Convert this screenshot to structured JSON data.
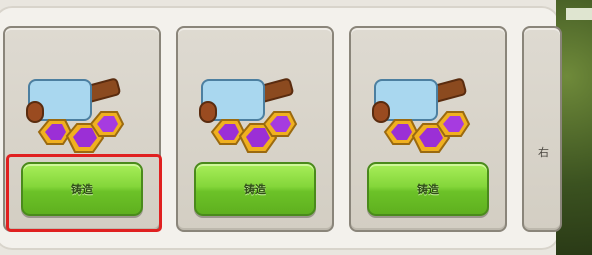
{
  "cards": [
    {
      "button_label": "铸造",
      "selected": true
    },
    {
      "button_label": "铸造",
      "selected": false
    },
    {
      "button_label": "铸造",
      "selected": false
    }
  ],
  "partial_card_text": "右",
  "item": {
    "icon": "hammer-with-gems-icon"
  },
  "colors": {
    "button_green": "#84d63a",
    "highlight_red": "#e02020",
    "gem_purple": "#9b2fd6",
    "gem_gold": "#f0b020"
  }
}
